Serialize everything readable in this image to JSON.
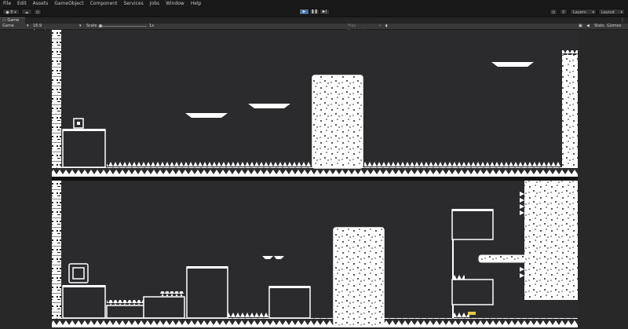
{
  "menu": [
    "File",
    "Edit",
    "Assets",
    "GameObject",
    "Component",
    "Services",
    "Jobs",
    "Window",
    "Help"
  ],
  "toolbar": {
    "account_label": "B",
    "layers_label": "Layers",
    "layout_label": "Layout"
  },
  "tab": {
    "label": "Game"
  },
  "gamebar": {
    "display": "Game",
    "aspect": "16:9 Aspect",
    "scale_label": "Scale",
    "scale_value": "1x",
    "play_focused": "Play Focused",
    "stats": "Stats",
    "gizmos": "Gizmos"
  },
  "colors": {
    "bg": "#282828",
    "game_bg": "#2b2a2d",
    "platform": "#ffffff",
    "accent_play": "#4d6f9a",
    "bar": "#1e1e1e"
  }
}
